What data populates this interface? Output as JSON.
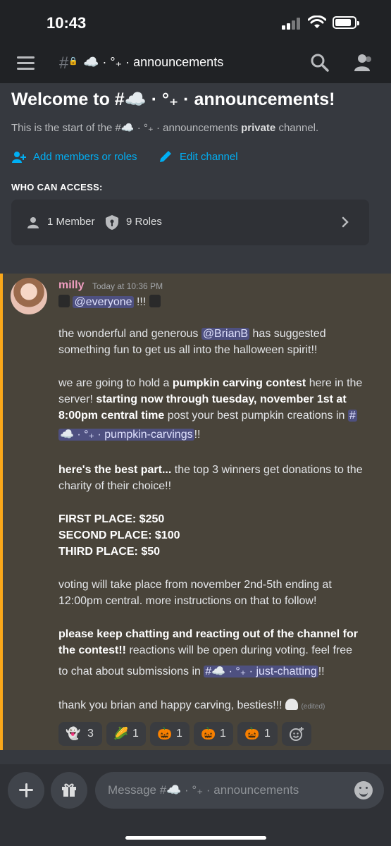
{
  "status": {
    "time": "10:43"
  },
  "top_bar": {
    "channel_name": "☁️ · °₊ · announcements"
  },
  "welcome": {
    "title": "Welcome to #☁️ · °₊ · announcements!",
    "subtitle_pre": "This is the start of the #☁️ · °₊ · announcements ",
    "subtitle_bold": "private",
    "subtitle_post": " channel.",
    "add_members_label": "Add members or roles",
    "edit_channel_label": "Edit channel",
    "who_can_access_label": "WHO CAN ACCESS:",
    "members_label": "1 Member",
    "roles_label": "9 Roles"
  },
  "message": {
    "author": "milly",
    "timestamp": "Today at 10:36 PM",
    "everyone_mention": "@everyone",
    "everyone_suffix": " !!!",
    "p1_l1_pre": "the wonderful and generous ",
    "p1_l1_mention": "@BrianB",
    "p1_l1_post": " has suggested",
    "p1_l2": "something fun to get us all into the halloween spirit!!",
    "p2_l1_pre": "we are going to hold a ",
    "p2_l1_bold": "pumpkin carving contest",
    "p2_l1_post": " here in the",
    "p2_l2_pre": "server! ",
    "p2_l2_bold": "starting now through tuesday, november 1st at",
    "p2_l3_bold": "8:00pm central time",
    "p2_l3_post": " post your best pumpkin creations in ",
    "p2_l3_hash": "#",
    "p2_l4_mention": "☁️ · °₊ · pumpkin-carvings",
    "p2_l4_post": "!!",
    "p3_l1_bold": "here's the best part...",
    "p3_l1_post": " the top 3 winners get donations to the",
    "p3_l2": "charity of their choice!!",
    "prize_first": "FIRST PLACE: $250",
    "prize_second": "SECOND PLACE: $100",
    "prize_third": "THIRD PLACE: $50",
    "p5_l1": "voting will take place from november 2nd-5th ending at",
    "p5_l2": "12:00pm central. more instructions on that to follow!",
    "p6_l1_bold": "please keep chatting and reacting out of the channel for",
    "p6_l2_bold": "the contest!!",
    "p6_l2_post": " reactions will be open during voting. feel free",
    "p6_l3_pre": "to chat about submissions in ",
    "p6_l3_mention": "#☁️ · °₊ · just-chatting",
    "p6_l3_post": "!!",
    "p7": "thank you brian and happy carving, besties!!! ",
    "edited_label": "(edited)"
  },
  "reactions": [
    {
      "emoji": "👻",
      "count": "3"
    },
    {
      "emoji": "🌽",
      "count": "1"
    },
    {
      "emoji": "🎃",
      "count": "1"
    },
    {
      "emoji": "🎃",
      "count": "1"
    },
    {
      "emoji": "🎃",
      "count": "1"
    }
  ],
  "composer": {
    "placeholder": "Message #☁️ · °₊ · announcements"
  },
  "colors": {
    "accent": "#faa81a",
    "link": "#00aff4",
    "username": "#f19ec1"
  }
}
